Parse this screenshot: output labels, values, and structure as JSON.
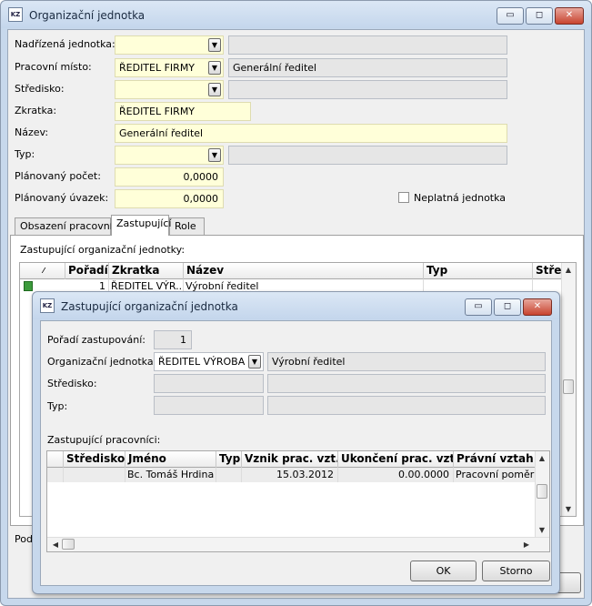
{
  "main_window": {
    "title": "Organizační jednotka",
    "app_icon": "KZ",
    "controls": {
      "minimize": "▭",
      "maximize": "◻",
      "close": "✕"
    },
    "form": {
      "nadrizena_label": "Nadřízená jednotka:",
      "nadrizena_value": "",
      "nadrizena_desc": "",
      "pracovni_misto_label": "Pracovní místo:",
      "pracovni_misto_value": "ŘEDITEL FIRMY",
      "pracovni_misto_desc": "Generální ředitel",
      "stredisko_label": "Středisko:",
      "stredisko_value": "",
      "stredisko_desc": "",
      "zkratka_label": "Zkratka:",
      "zkratka_value": "ŘEDITEL FIRMY",
      "nazev_label": "Název:",
      "nazev_value": "Generální ředitel",
      "typ_label": "Typ:",
      "typ_value": "",
      "typ_desc": "",
      "planovany_pocet_label": "Plánovaný počet:",
      "planovany_pocet_value": "0,0000",
      "planovany_uvazek_label": "Plánovaný úvazek:",
      "planovany_uvazek_value": "0,0000",
      "neplatna_label": "Neplatná jednotka"
    },
    "tabs": [
      "Obsazení pracovníci",
      "Zastupující",
      "Role"
    ],
    "active_tab": "Zastupující",
    "panel_label": "Zastupující organizační jednotky:",
    "grid": {
      "columns": [
        "",
        "Pořadí",
        "Zkratka",
        "Název",
        "Typ",
        "Středis"
      ],
      "rows": [
        {
          "poradi": "1",
          "zkratka": "ŘEDITEL VÝR...",
          "nazev": "Výrobní ředitel",
          "typ": ""
        }
      ]
    },
    "footer_label_partial": "Podř",
    "scroll_up": "▲",
    "scroll_down": "▼"
  },
  "dialog": {
    "title": "Zastupující organizační jednotka",
    "controls": {
      "minimize": "▭",
      "maximize": "◻",
      "close": "✕"
    },
    "poradi_label": "Pořadí zastupování:",
    "poradi_value": "1",
    "org_label": "Organizační jednotka:",
    "org_value": "ŘEDITEL VÝROBA",
    "org_desc": "Výrobní ředitel",
    "stredisko_label": "Středisko:",
    "typ_label": "Typ:",
    "workers_label": "Zastupující pracovníci:",
    "grid": {
      "columns": [
        "",
        "Středisko",
        "Jméno",
        "Typ",
        "Vznik prac. vzt.",
        "Ukončení prac. vzt.",
        "Právní vztah"
      ],
      "rows": [
        {
          "stredisko": "",
          "jmeno": "Bc. Tomáš Hrdina",
          "typ": "",
          "vznik": "15.03.2012",
          "ukonceni": "0.00.0000",
          "pravni": "Pracovní poměr"
        }
      ]
    },
    "ok_label": "OK",
    "storno_label": "Storno",
    "scroll_up": "▲",
    "scroll_down": "▼",
    "scroll_left": "◀",
    "scroll_right": "▶"
  }
}
